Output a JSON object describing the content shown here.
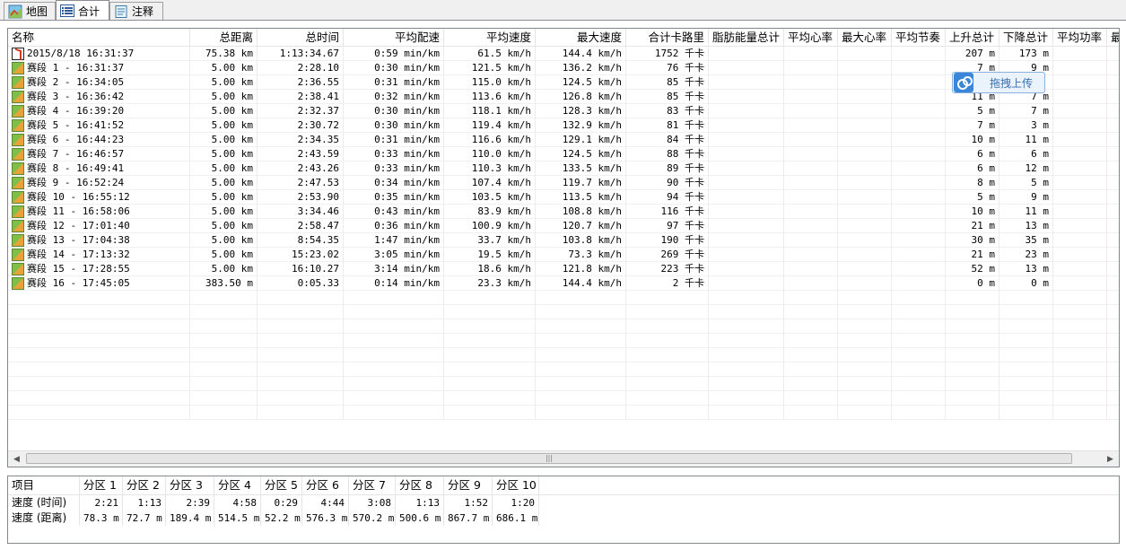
{
  "tabs": [
    {
      "label": "地图",
      "icon": "map-icon"
    },
    {
      "label": "合计",
      "icon": "list-icon"
    },
    {
      "label": "注释",
      "icon": "note-icon"
    }
  ],
  "table": {
    "columns": [
      "名称",
      "总距离",
      "总时间",
      "平均配速",
      "平均速度",
      "最大速度",
      "合计卡路里",
      "脂肪能量总计",
      "平均心率",
      "最大心率",
      "平均节奏",
      "上升总计",
      "下降总计",
      "平均功率",
      "最"
    ],
    "rows": [
      {
        "icon": "activity",
        "name": "2015/8/18 16:31:37",
        "dist": "75.38 km",
        "time": "1:13:34.67",
        "pace": "0:59 min/km",
        "avg": "61.5 km/h",
        "max": "144.4 km/h",
        "cal": "1752 千卡",
        "up": "207 m",
        "down": "173 m"
      },
      {
        "icon": "segment",
        "name": "赛段 1 - 16:31:37",
        "dist": "5.00 km",
        "time": "2:28.10",
        "pace": "0:30 min/km",
        "avg": "121.5 km/h",
        "max": "136.2 km/h",
        "cal": "76 千卡",
        "up": "7 m",
        "down": "9 m"
      },
      {
        "icon": "segment",
        "name": "赛段 2 - 16:34:05",
        "dist": "5.00 km",
        "time": "2:36.55",
        "pace": "0:31 min/km",
        "avg": "115.0 km/h",
        "max": "124.5 km/h",
        "cal": "85 千卡",
        "up": "",
        "down": ""
      },
      {
        "icon": "segment",
        "name": "赛段 3 - 16:36:42",
        "dist": "5.00 km",
        "time": "2:38.41",
        "pace": "0:32 min/km",
        "avg": "113.6 km/h",
        "max": "126.8 km/h",
        "cal": "85 千卡",
        "up": "11 m",
        "down": "7 m"
      },
      {
        "icon": "segment",
        "name": "赛段 4 - 16:39:20",
        "dist": "5.00 km",
        "time": "2:32.37",
        "pace": "0:30 min/km",
        "avg": "118.1 km/h",
        "max": "128.3 km/h",
        "cal": "83 千卡",
        "up": "5 m",
        "down": "7 m"
      },
      {
        "icon": "segment",
        "name": "赛段 5 - 16:41:52",
        "dist": "5.00 km",
        "time": "2:30.72",
        "pace": "0:30 min/km",
        "avg": "119.4 km/h",
        "max": "132.9 km/h",
        "cal": "81 千卡",
        "up": "7 m",
        "down": "3 m"
      },
      {
        "icon": "segment",
        "name": "赛段 6 - 16:44:23",
        "dist": "5.00 km",
        "time": "2:34.35",
        "pace": "0:31 min/km",
        "avg": "116.6 km/h",
        "max": "129.1 km/h",
        "cal": "84 千卡",
        "up": "10 m",
        "down": "11 m"
      },
      {
        "icon": "segment",
        "name": "赛段 7 - 16:46:57",
        "dist": "5.00 km",
        "time": "2:43.59",
        "pace": "0:33 min/km",
        "avg": "110.0 km/h",
        "max": "124.5 km/h",
        "cal": "88 千卡",
        "up": "6 m",
        "down": "6 m"
      },
      {
        "icon": "segment",
        "name": "赛段 8 - 16:49:41",
        "dist": "5.00 km",
        "time": "2:43.26",
        "pace": "0:33 min/km",
        "avg": "110.3 km/h",
        "max": "133.5 km/h",
        "cal": "89 千卡",
        "up": "6 m",
        "down": "12 m"
      },
      {
        "icon": "segment",
        "name": "赛段 9 - 16:52:24",
        "dist": "5.00 km",
        "time": "2:47.53",
        "pace": "0:34 min/km",
        "avg": "107.4 km/h",
        "max": "119.7 km/h",
        "cal": "90 千卡",
        "up": "8 m",
        "down": "5 m"
      },
      {
        "icon": "segment",
        "name": "赛段 10 - 16:55:12",
        "dist": "5.00 km",
        "time": "2:53.90",
        "pace": "0:35 min/km",
        "avg": "103.5 km/h",
        "max": "113.5 km/h",
        "cal": "94 千卡",
        "up": "5 m",
        "down": "9 m"
      },
      {
        "icon": "segment",
        "name": "赛段 11 - 16:58:06",
        "dist": "5.00 km",
        "time": "3:34.46",
        "pace": "0:43 min/km",
        "avg": "83.9 km/h",
        "max": "108.8 km/h",
        "cal": "116 千卡",
        "up": "10 m",
        "down": "11 m"
      },
      {
        "icon": "segment",
        "name": "赛段 12 - 17:01:40",
        "dist": "5.00 km",
        "time": "2:58.47",
        "pace": "0:36 min/km",
        "avg": "100.9 km/h",
        "max": "120.7 km/h",
        "cal": "97 千卡",
        "up": "21 m",
        "down": "13 m"
      },
      {
        "icon": "segment",
        "name": "赛段 13 - 17:04:38",
        "dist": "5.00 km",
        "time": "8:54.35",
        "pace": "1:47 min/km",
        "avg": "33.7 km/h",
        "max": "103.8 km/h",
        "cal": "190 千卡",
        "up": "30 m",
        "down": "35 m"
      },
      {
        "icon": "segment",
        "name": "赛段 14 - 17:13:32",
        "dist": "5.00 km",
        "time": "15:23.02",
        "pace": "3:05 min/km",
        "avg": "19.5 km/h",
        "max": "73.3 km/h",
        "cal": "269 千卡",
        "up": "21 m",
        "down": "23 m"
      },
      {
        "icon": "segment",
        "name": "赛段 15 - 17:28:55",
        "dist": "5.00 km",
        "time": "16:10.27",
        "pace": "3:14 min/km",
        "avg": "18.6 km/h",
        "max": "121.8 km/h",
        "cal": "223 千卡",
        "up": "52 m",
        "down": "13 m"
      },
      {
        "icon": "segment",
        "name": "赛段 16 - 17:45:05",
        "dist": "383.50 m",
        "time": "0:05.33",
        "pace": "0:14 min/km",
        "avg": "23.3 km/h",
        "max": "144.4 km/h",
        "cal": "2 千卡",
        "up": "0 m",
        "down": "0 m"
      }
    ]
  },
  "upload_button": {
    "label": "拖拽上传"
  },
  "zones": {
    "header": [
      "项目",
      "分区 1",
      "分区 2",
      "分区 3",
      "分区 4",
      "分区 5",
      "分区 6",
      "分区 7",
      "分区 8",
      "分区 9",
      "分区 10"
    ],
    "rows": [
      {
        "label": "速度 (时间)",
        "values": [
          "2:21",
          "1:13",
          "2:39",
          "4:58",
          "0:29",
          "4:44",
          "3:08",
          "1:13",
          "1:52",
          "1:20"
        ]
      },
      {
        "label": "速度 (距离)",
        "values": [
          "78.3 m",
          "72.7 m",
          "189.4 m",
          "514.5 m",
          "52.2 m",
          "576.3 m",
          "570.2 m",
          "500.6 m",
          "867.7 m",
          "686.1 m"
        ]
      }
    ]
  }
}
